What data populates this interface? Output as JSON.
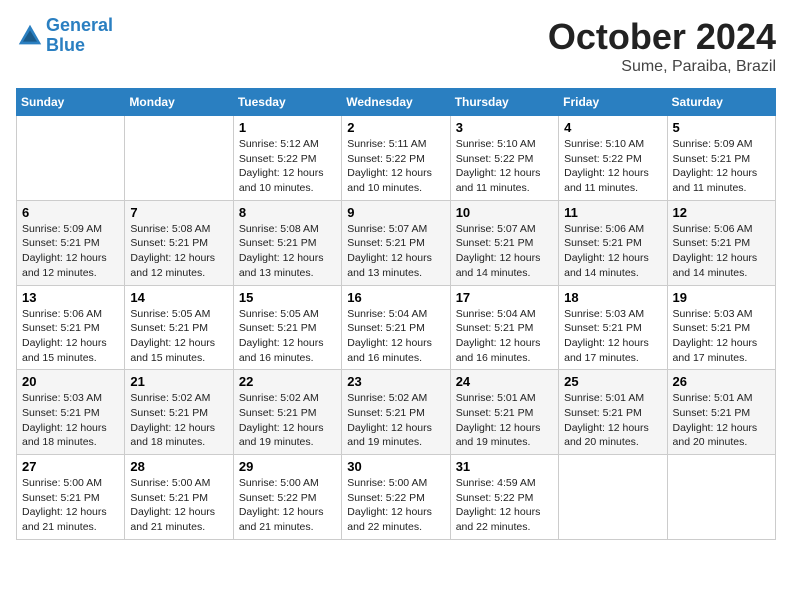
{
  "header": {
    "logo_line1": "General",
    "logo_line2": "Blue",
    "month": "October 2024",
    "location": "Sume, Paraiba, Brazil"
  },
  "weekdays": [
    "Sunday",
    "Monday",
    "Tuesday",
    "Wednesday",
    "Thursday",
    "Friday",
    "Saturday"
  ],
  "weeks": [
    [
      {
        "day": "",
        "info": ""
      },
      {
        "day": "",
        "info": ""
      },
      {
        "day": "1",
        "info": "Sunrise: 5:12 AM\nSunset: 5:22 PM\nDaylight: 12 hours and 10 minutes."
      },
      {
        "day": "2",
        "info": "Sunrise: 5:11 AM\nSunset: 5:22 PM\nDaylight: 12 hours and 10 minutes."
      },
      {
        "day": "3",
        "info": "Sunrise: 5:10 AM\nSunset: 5:22 PM\nDaylight: 12 hours and 11 minutes."
      },
      {
        "day": "4",
        "info": "Sunrise: 5:10 AM\nSunset: 5:22 PM\nDaylight: 12 hours and 11 minutes."
      },
      {
        "day": "5",
        "info": "Sunrise: 5:09 AM\nSunset: 5:21 PM\nDaylight: 12 hours and 11 minutes."
      }
    ],
    [
      {
        "day": "6",
        "info": "Sunrise: 5:09 AM\nSunset: 5:21 PM\nDaylight: 12 hours and 12 minutes."
      },
      {
        "day": "7",
        "info": "Sunrise: 5:08 AM\nSunset: 5:21 PM\nDaylight: 12 hours and 12 minutes."
      },
      {
        "day": "8",
        "info": "Sunrise: 5:08 AM\nSunset: 5:21 PM\nDaylight: 12 hours and 13 minutes."
      },
      {
        "day": "9",
        "info": "Sunrise: 5:07 AM\nSunset: 5:21 PM\nDaylight: 12 hours and 13 minutes."
      },
      {
        "day": "10",
        "info": "Sunrise: 5:07 AM\nSunset: 5:21 PM\nDaylight: 12 hours and 14 minutes."
      },
      {
        "day": "11",
        "info": "Sunrise: 5:06 AM\nSunset: 5:21 PM\nDaylight: 12 hours and 14 minutes."
      },
      {
        "day": "12",
        "info": "Sunrise: 5:06 AM\nSunset: 5:21 PM\nDaylight: 12 hours and 14 minutes."
      }
    ],
    [
      {
        "day": "13",
        "info": "Sunrise: 5:06 AM\nSunset: 5:21 PM\nDaylight: 12 hours and 15 minutes."
      },
      {
        "day": "14",
        "info": "Sunrise: 5:05 AM\nSunset: 5:21 PM\nDaylight: 12 hours and 15 minutes."
      },
      {
        "day": "15",
        "info": "Sunrise: 5:05 AM\nSunset: 5:21 PM\nDaylight: 12 hours and 16 minutes."
      },
      {
        "day": "16",
        "info": "Sunrise: 5:04 AM\nSunset: 5:21 PM\nDaylight: 12 hours and 16 minutes."
      },
      {
        "day": "17",
        "info": "Sunrise: 5:04 AM\nSunset: 5:21 PM\nDaylight: 12 hours and 16 minutes."
      },
      {
        "day": "18",
        "info": "Sunrise: 5:03 AM\nSunset: 5:21 PM\nDaylight: 12 hours and 17 minutes."
      },
      {
        "day": "19",
        "info": "Sunrise: 5:03 AM\nSunset: 5:21 PM\nDaylight: 12 hours and 17 minutes."
      }
    ],
    [
      {
        "day": "20",
        "info": "Sunrise: 5:03 AM\nSunset: 5:21 PM\nDaylight: 12 hours and 18 minutes."
      },
      {
        "day": "21",
        "info": "Sunrise: 5:02 AM\nSunset: 5:21 PM\nDaylight: 12 hours and 18 minutes."
      },
      {
        "day": "22",
        "info": "Sunrise: 5:02 AM\nSunset: 5:21 PM\nDaylight: 12 hours and 19 minutes."
      },
      {
        "day": "23",
        "info": "Sunrise: 5:02 AM\nSunset: 5:21 PM\nDaylight: 12 hours and 19 minutes."
      },
      {
        "day": "24",
        "info": "Sunrise: 5:01 AM\nSunset: 5:21 PM\nDaylight: 12 hours and 19 minutes."
      },
      {
        "day": "25",
        "info": "Sunrise: 5:01 AM\nSunset: 5:21 PM\nDaylight: 12 hours and 20 minutes."
      },
      {
        "day": "26",
        "info": "Sunrise: 5:01 AM\nSunset: 5:21 PM\nDaylight: 12 hours and 20 minutes."
      }
    ],
    [
      {
        "day": "27",
        "info": "Sunrise: 5:00 AM\nSunset: 5:21 PM\nDaylight: 12 hours and 21 minutes."
      },
      {
        "day": "28",
        "info": "Sunrise: 5:00 AM\nSunset: 5:21 PM\nDaylight: 12 hours and 21 minutes."
      },
      {
        "day": "29",
        "info": "Sunrise: 5:00 AM\nSunset: 5:22 PM\nDaylight: 12 hours and 21 minutes."
      },
      {
        "day": "30",
        "info": "Sunrise: 5:00 AM\nSunset: 5:22 PM\nDaylight: 12 hours and 22 minutes."
      },
      {
        "day": "31",
        "info": "Sunrise: 4:59 AM\nSunset: 5:22 PM\nDaylight: 12 hours and 22 minutes."
      },
      {
        "day": "",
        "info": ""
      },
      {
        "day": "",
        "info": ""
      }
    ]
  ]
}
